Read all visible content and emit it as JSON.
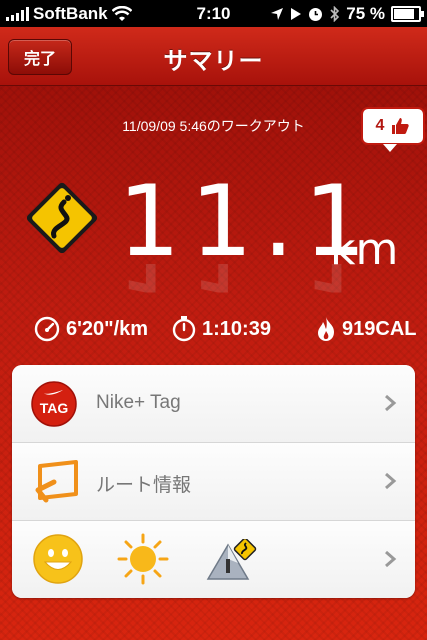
{
  "status_bar": {
    "carrier": "SoftBank",
    "time": "7:10",
    "battery": "75 %",
    "battery_level": 0.75
  },
  "nav": {
    "done_label": "完了",
    "title": "サマリー"
  },
  "summary": {
    "workout_date": "11/09/09 5:46のワークアウト",
    "like_count": "4",
    "distance_value": "11.1",
    "distance_unit": "km",
    "pace": "6'20\"/km",
    "duration": "1:10:39",
    "calories": "919CAL"
  },
  "menu": {
    "tag_icon_text": "TAG",
    "nike_tag_label": "Nike+ Tag",
    "route_label": "ルート情報"
  },
  "colors": {
    "brand_red": "#c01c10",
    "nav_red": "#a8120b",
    "label_gray": "#777777"
  }
}
